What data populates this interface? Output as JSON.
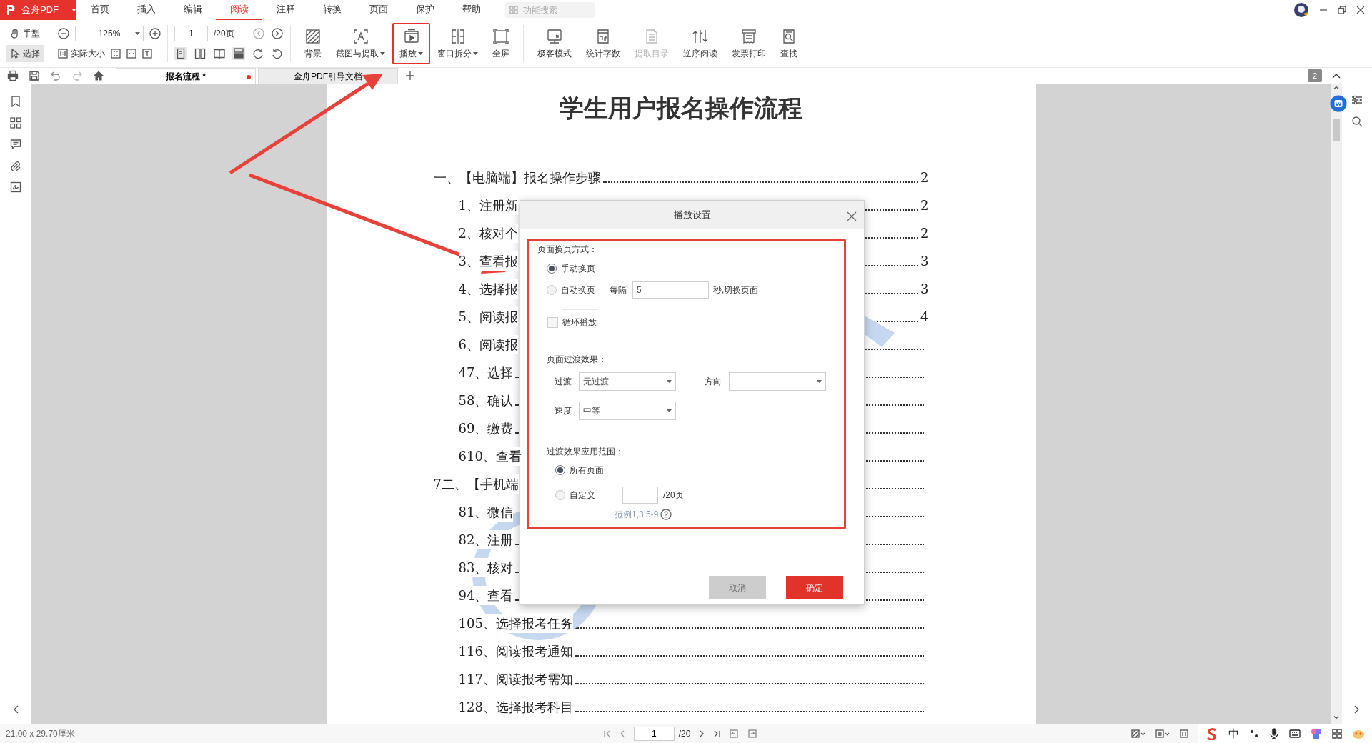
{
  "app": {
    "logo": "金舟PDF",
    "menu": [
      {
        "label": "首页",
        "selected": false
      },
      {
        "label": "插入",
        "selected": false
      },
      {
        "label": "编辑",
        "selected": false
      },
      {
        "label": "阅读",
        "selected": true
      },
      {
        "label": "注释",
        "selected": false
      },
      {
        "label": "转换",
        "selected": false
      },
      {
        "label": "页面",
        "selected": false
      },
      {
        "label": "保护",
        "selected": false
      },
      {
        "label": "帮助",
        "selected": false
      }
    ],
    "search": {
      "placeholder": "功能搜索"
    }
  },
  "toolbar": {
    "tools": [
      {
        "label": "手型",
        "selected": false
      },
      {
        "label": "选择",
        "selected": true
      }
    ],
    "zoom": "125%",
    "actual_size": "实际大小",
    "page": "1",
    "page_total": "/20页",
    "buttons": [
      {
        "label": "背景",
        "dropdown": false,
        "disabled": false,
        "highlighted": false
      },
      {
        "label": "截图与提取",
        "dropdown": true,
        "disabled": false,
        "highlighted": false
      },
      {
        "label": "播放",
        "dropdown": true,
        "disabled": false,
        "highlighted": true
      },
      {
        "label": "窗口拆分",
        "dropdown": true,
        "disabled": false,
        "highlighted": false
      },
      {
        "label": "全屏",
        "dropdown": false,
        "disabled": false,
        "highlighted": false
      },
      {
        "label": "极客模式",
        "dropdown": false,
        "disabled": false,
        "highlighted": false
      },
      {
        "label": "统计字数",
        "dropdown": false,
        "disabled": false,
        "highlighted": false
      },
      {
        "label": "提取目录",
        "dropdown": false,
        "disabled": true,
        "highlighted": false
      },
      {
        "label": "逆序阅读",
        "dropdown": false,
        "disabled": false,
        "highlighted": false
      },
      {
        "label": "发票打印",
        "dropdown": false,
        "disabled": false,
        "highlighted": false
      },
      {
        "label": "查找",
        "dropdown": false,
        "disabled": false,
        "highlighted": false
      }
    ]
  },
  "tabs": [
    {
      "label": "报名流程 *",
      "selected": true,
      "modified": true
    },
    {
      "label": "金舟PDF引导文档",
      "selected": false,
      "modified": false
    }
  ],
  "page_badge": "2",
  "document": {
    "title": "学生用户报名操作流程",
    "toc": [
      {
        "text": "一、【电脑端】报名操作步骤",
        "page": "2",
        "children": [
          {
            "text": "1、注册新",
            "page": "2"
          },
          {
            "text": "2、核对个",
            "page": "2"
          },
          {
            "text": "3、查看报",
            "page": "3"
          },
          {
            "text": "4、选择报",
            "page": "3"
          },
          {
            "text": "5、阅读报",
            "page": "4"
          },
          {
            "text": "6、阅读报"
          },
          {
            "text": "47、选择"
          },
          {
            "text": "58、确认"
          },
          {
            "text": "69、缴费"
          },
          {
            "text": "610、查看"
          }
        ]
      },
      {
        "text": "7二、【手机端",
        "children": [
          {
            "text": "81、微信"
          },
          {
            "text": "82、注册"
          },
          {
            "text": "83、核对"
          },
          {
            "text": "94、查看"
          },
          {
            "text": "105、选择报考任务"
          },
          {
            "text": "116、阅读报考通知"
          },
          {
            "text": "117、阅读报考需知"
          },
          {
            "text": "128、选择报考科目"
          }
        ]
      }
    ]
  },
  "dialog": {
    "title": "播放设置",
    "paging": {
      "label": "页面换页方式：",
      "options": [
        {
          "label": "手动换页",
          "selected": true
        },
        {
          "label": "自动换页",
          "selected": false
        }
      ],
      "interval_label": "每隔",
      "interval": "5",
      "interval_suffix": "秒,切换页面",
      "loop": {
        "label": "循环播放",
        "checked": false
      }
    },
    "transition": {
      "label": "页面过渡效果：",
      "effect_label": "过渡",
      "effect": "无过渡",
      "direction_label": "方向",
      "speed_label": "速度",
      "speed": "中等"
    },
    "scope": {
      "label": "过渡效果应用范围：",
      "options": [
        {
          "label": "所有页面",
          "selected": true
        },
        {
          "label": "自定义",
          "selected": false
        }
      ],
      "page_total": "/20页",
      "hint": "范例1,3,5-9"
    },
    "buttons": [
      {
        "label": "取消",
        "kind": "secondary",
        "disabled": true
      },
      {
        "label": "确定",
        "kind": "primary",
        "disabled": false
      }
    ]
  },
  "status_bar": {
    "page_size": "21.00 x 29.70厘米",
    "page": "1",
    "page_total": "/20",
    "ime": "中"
  }
}
